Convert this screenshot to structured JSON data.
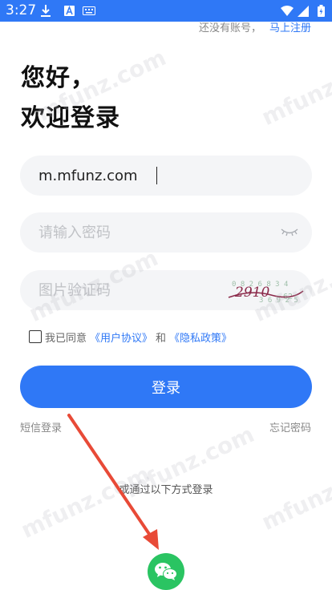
{
  "status_bar": {
    "time": "3:27",
    "icons": [
      "download-icon",
      "a-icon",
      "keyboard-icon",
      "wifi-icon",
      "signal-icon",
      "battery-icon"
    ]
  },
  "header": {
    "no_account_text": "还没有账号，",
    "register_link": "马上注册"
  },
  "greeting": {
    "line1": "您好，",
    "line2": "欢迎登录"
  },
  "form": {
    "account_value": "m.mfunz.com",
    "password_placeholder": "请输入密码",
    "captcha_placeholder": "图片验证码",
    "captcha_text": "2910"
  },
  "agreement": {
    "checked": false,
    "prefix": "我已同意",
    "user_agreement": "《用户协议》",
    "and": "和",
    "privacy_policy": "《隐私政策》"
  },
  "actions": {
    "login_label": "登录",
    "sms_login": "短信登录",
    "forgot_password": "忘记密码"
  },
  "other_login": {
    "label": "或通过以下方式登录",
    "methods": [
      "wechat-icon"
    ]
  },
  "colors": {
    "primary": "#2f78f6",
    "wechat": "#2ac462",
    "annotation_arrow": "#e84a37"
  },
  "watermark_text": "mfunz.com"
}
